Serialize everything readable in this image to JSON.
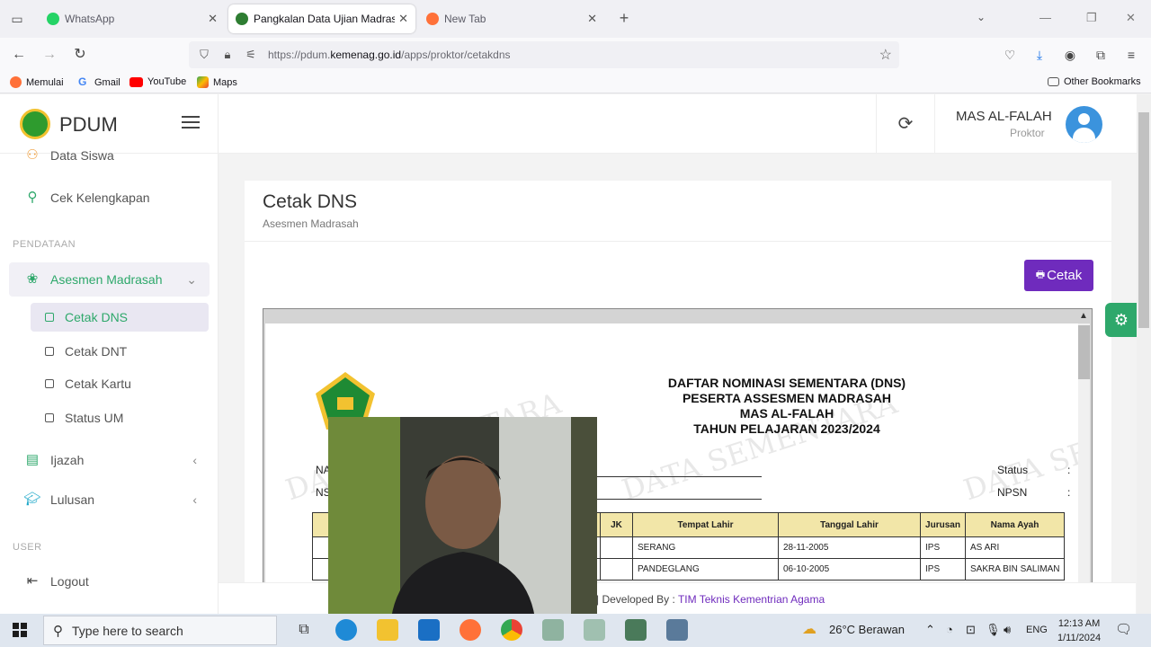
{
  "browser": {
    "tabs": [
      {
        "title": "WhatsApp",
        "active": false,
        "color": "#25d366"
      },
      {
        "title": "Pangkalan Data Ujian Madrasah",
        "active": true,
        "color": "#2e7d32"
      },
      {
        "title": "New Tab",
        "active": false,
        "color": "#ff7139"
      }
    ],
    "url_prefix": "https://pdum.",
    "url_domain": "kemenag.go.id",
    "url_path": "/apps/proktor/cetakdns",
    "bookmarks": [
      "Memulai",
      "Gmail",
      "YouTube",
      "Maps"
    ],
    "other_bookmarks": "Other Bookmarks"
  },
  "app": {
    "brand": "PDUM",
    "user_name": "MAS AL-FALAH",
    "user_role": "Proktor",
    "sidebar": {
      "data_siswa": "Data Siswa",
      "cek_kelengkapan": "Cek Kelengkapan",
      "section_pendataan": "PENDATAAN",
      "asesmen": "Asesmen Madrasah",
      "sub": [
        "Cetak DNS",
        "Cetak DNT",
        "Cetak Kartu",
        "Status UM"
      ],
      "ijazah": "Ijazah",
      "lulusan": "Lulusan",
      "section_user": "USER",
      "logout": "Logout"
    },
    "page_title": "Cetak DNS",
    "page_subtitle": "Asesmen Madrasah",
    "print_button": "Cetak",
    "document": {
      "title_lines": [
        "DAFTAR NOMINASI SEMENTARA (DNS)",
        "PESERTA ASSESMEN MADRASAH",
        "MAS AL-FALAH",
        "TAHUN PELAJARAN 2023/2024"
      ],
      "watermark": "DATA SEMENTARA",
      "field_na": "NA",
      "field_ns": "NS",
      "field_status": "Status",
      "field_npsn": "NPSN",
      "colon": ":",
      "columns": [
        "JK",
        "Tempat Lahir",
        "Tanggal Lahir",
        "Jurusan",
        "Nama Ayah"
      ],
      "rows": [
        [
          "",
          "SERANG",
          "28-11-2005",
          "IPS",
          "AS ARI"
        ],
        [
          "",
          "PANDEGLANG",
          "06-10-2005",
          "IPS",
          "SAKRA BIN SALIMAN"
        ]
      ]
    },
    "footer_prefix": "| Developed By : ",
    "footer_link": "TIM Teknis Kementrian Agama"
  },
  "taskbar": {
    "search_placeholder": "Type here to search",
    "weather": "26°C  Berawan",
    "language": "ENG",
    "time": "12:13 AM",
    "date": "1/11/2024"
  }
}
